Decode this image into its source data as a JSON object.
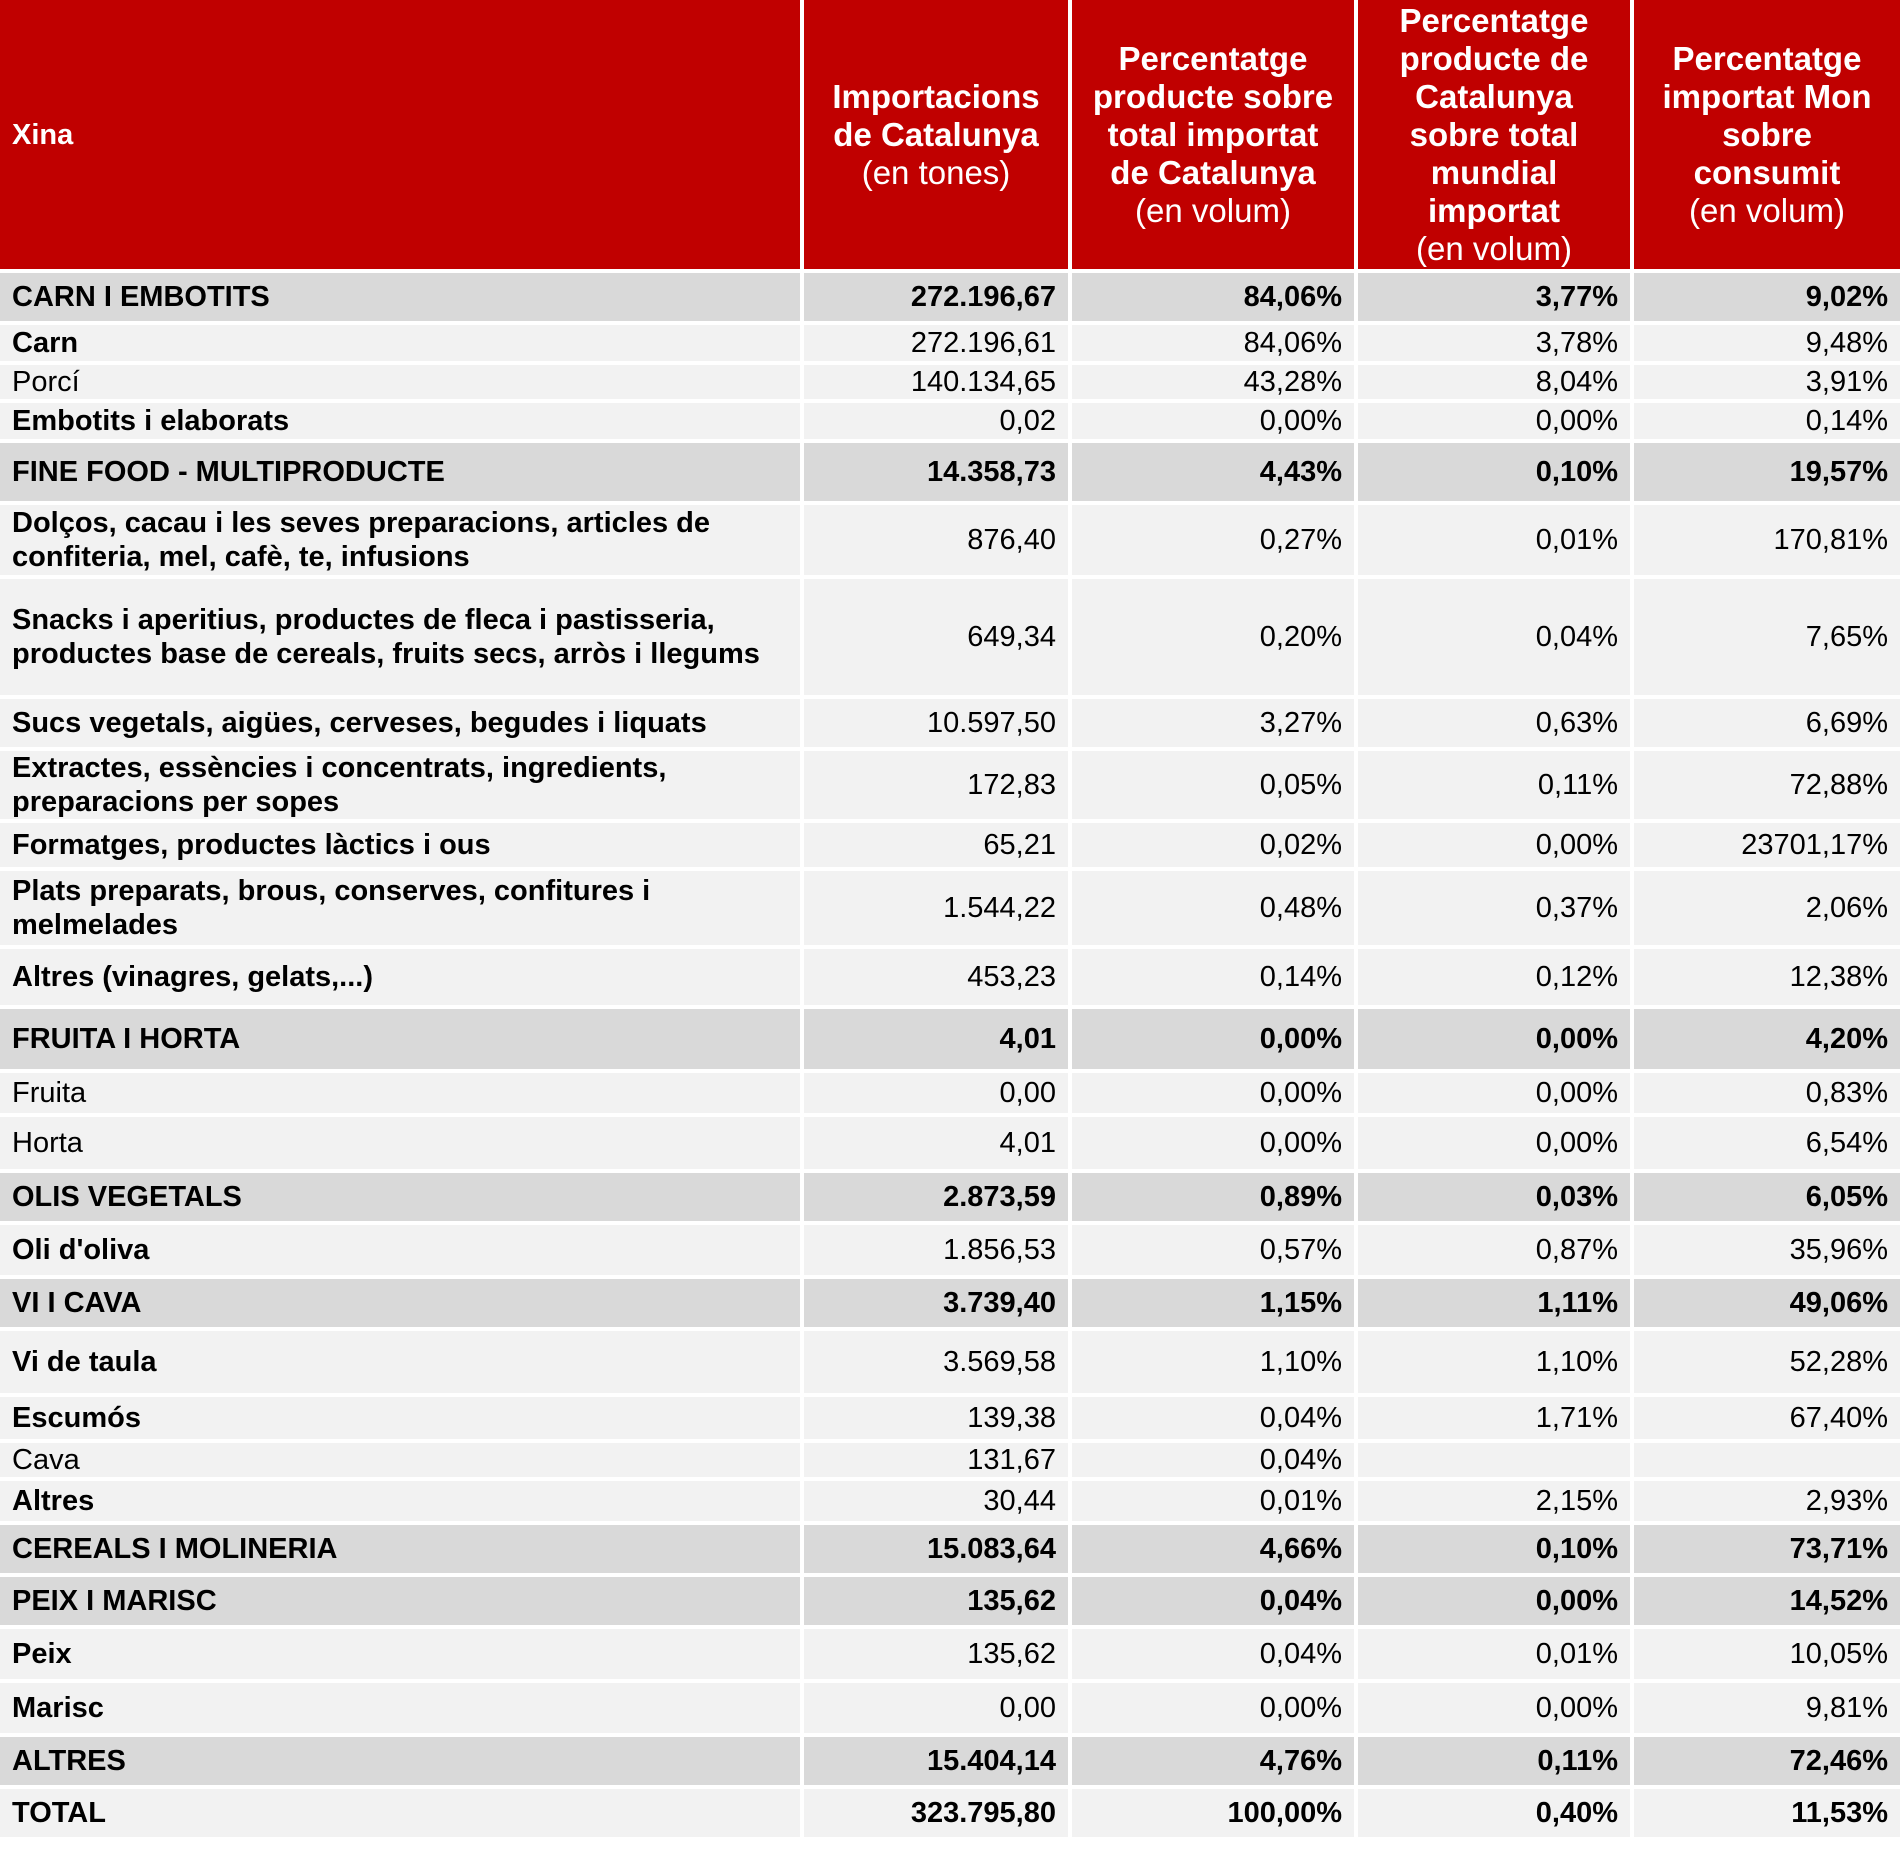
{
  "header": {
    "label": "Xina",
    "col1": {
      "main": "Importacions de Catalunya",
      "sub": "(en tones)"
    },
    "col2": {
      "main": "Percentatge producte sobre total importat de Catalunya",
      "sub": "(en volum)"
    },
    "col3": {
      "main": "Percentatge producte de Catalunya sobre total mundial importat",
      "sub": "(en volum)"
    },
    "col4": {
      "main": "Percentatge importat Mon sobre consumit",
      "sub": "(en volum)"
    }
  },
  "rows": [
    {
      "type": "cat",
      "label": "CARN I EMBOTITS",
      "v": [
        "272.196,67",
        "84,06%",
        "3,77%",
        "9,02%"
      ]
    },
    {
      "type": "sub",
      "label": "Carn",
      "v": [
        "272.196,61",
        "84,06%",
        "3,78%",
        "9,48%"
      ]
    },
    {
      "type": "item",
      "label": "Porcí",
      "v": [
        "140.134,65",
        "43,28%",
        "8,04%",
        "3,91%"
      ]
    },
    {
      "type": "sub",
      "label": "Embotits i elaborats",
      "v": [
        "0,02",
        "0,00%",
        "0,00%",
        "0,14%"
      ]
    },
    {
      "type": "cat",
      "label": "FINE FOOD - MULTIPRODUCTE",
      "v": [
        "14.358,73",
        "4,43%",
        "0,10%",
        "19,57%"
      ]
    },
    {
      "type": "sub",
      "label": "Dolços, cacau i les seves preparacions, articles de confiteria, mel, cafè, te, infusions",
      "v": [
        "876,40",
        "0,27%",
        "0,01%",
        "170,81%"
      ]
    },
    {
      "type": "sub",
      "label": "Snacks i aperitius, productes de fleca i pastisseria, productes base de cereals, fruits secs, arròs i llegums",
      "v": [
        "649,34",
        "0,20%",
        "0,04%",
        "7,65%"
      ]
    },
    {
      "type": "sub",
      "label": "Sucs vegetals, aigües, cerveses, begudes i liquats",
      "v": [
        "10.597,50",
        "3,27%",
        "0,63%",
        "6,69%"
      ]
    },
    {
      "type": "sub",
      "label": "Extractes, essències i concentrats, ingredients, preparacions per sopes",
      "v": [
        "172,83",
        "0,05%",
        "0,11%",
        "72,88%"
      ]
    },
    {
      "type": "sub",
      "label": "Formatges, productes làctics i ous",
      "v": [
        "65,21",
        "0,02%",
        "0,00%",
        "23701,17%"
      ]
    },
    {
      "type": "sub",
      "label": "Plats preparats, brous, conserves, confitures i melmelades",
      "v": [
        "1.544,22",
        "0,48%",
        "0,37%",
        "2,06%"
      ]
    },
    {
      "type": "sub",
      "label": "Altres (vinagres, gelats,...)",
      "v": [
        "453,23",
        "0,14%",
        "0,12%",
        "12,38%"
      ]
    },
    {
      "type": "cat",
      "label": "FRUITA I HORTA",
      "v": [
        "4,01",
        "0,00%",
        "0,00%",
        "4,20%"
      ]
    },
    {
      "type": "plain",
      "label": "Fruita",
      "v": [
        "0,00",
        "0,00%",
        "0,00%",
        "0,83%"
      ]
    },
    {
      "type": "plain",
      "label": "Horta",
      "v": [
        "4,01",
        "0,00%",
        "0,00%",
        "6,54%"
      ]
    },
    {
      "type": "cat",
      "label": "OLIS VEGETALS",
      "v": [
        "2.873,59",
        "0,89%",
        "0,03%",
        "6,05%"
      ]
    },
    {
      "type": "sub",
      "label": "Oli d'oliva",
      "v": [
        "1.856,53",
        "0,57%",
        "0,87%",
        "35,96%"
      ]
    },
    {
      "type": "cat",
      "label": "VI I CAVA",
      "v": [
        "3.739,40",
        "1,15%",
        "1,11%",
        "49,06%"
      ]
    },
    {
      "type": "sub",
      "label": "Vi de taula",
      "v": [
        "3.569,58",
        "1,10%",
        "1,10%",
        "52,28%"
      ]
    },
    {
      "type": "sub",
      "label": "Escumós",
      "v": [
        "139,38",
        "0,04%",
        "1,71%",
        "67,40%"
      ]
    },
    {
      "type": "item",
      "label": "Cava",
      "v": [
        "131,67",
        "0,04%",
        "",
        ""
      ]
    },
    {
      "type": "sub",
      "label": "Altres",
      "v": [
        "30,44",
        "0,01%",
        "2,15%",
        "2,93%"
      ]
    },
    {
      "type": "cat",
      "label": "CEREALS I MOLINERIA",
      "v": [
        "15.083,64",
        "4,66%",
        "0,10%",
        "73,71%"
      ]
    },
    {
      "type": "cat",
      "label": "PEIX I MARISC",
      "v": [
        "135,62",
        "0,04%",
        "0,00%",
        "14,52%"
      ]
    },
    {
      "type": "sub",
      "label": "Peix",
      "v": [
        "135,62",
        "0,04%",
        "0,01%",
        "10,05%"
      ]
    },
    {
      "type": "sub",
      "label": "Marisc",
      "v": [
        "0,00",
        "0,00%",
        "0,00%",
        "9,81%"
      ]
    },
    {
      "type": "cat",
      "label": "ALTRES",
      "v": [
        "15.404,14",
        "4,76%",
        "0,11%",
        "72,46%"
      ]
    },
    {
      "type": "total",
      "label": "TOTAL",
      "v": [
        "323.795,80",
        "100,00%",
        "0,40%",
        "11,53%"
      ]
    }
  ]
}
